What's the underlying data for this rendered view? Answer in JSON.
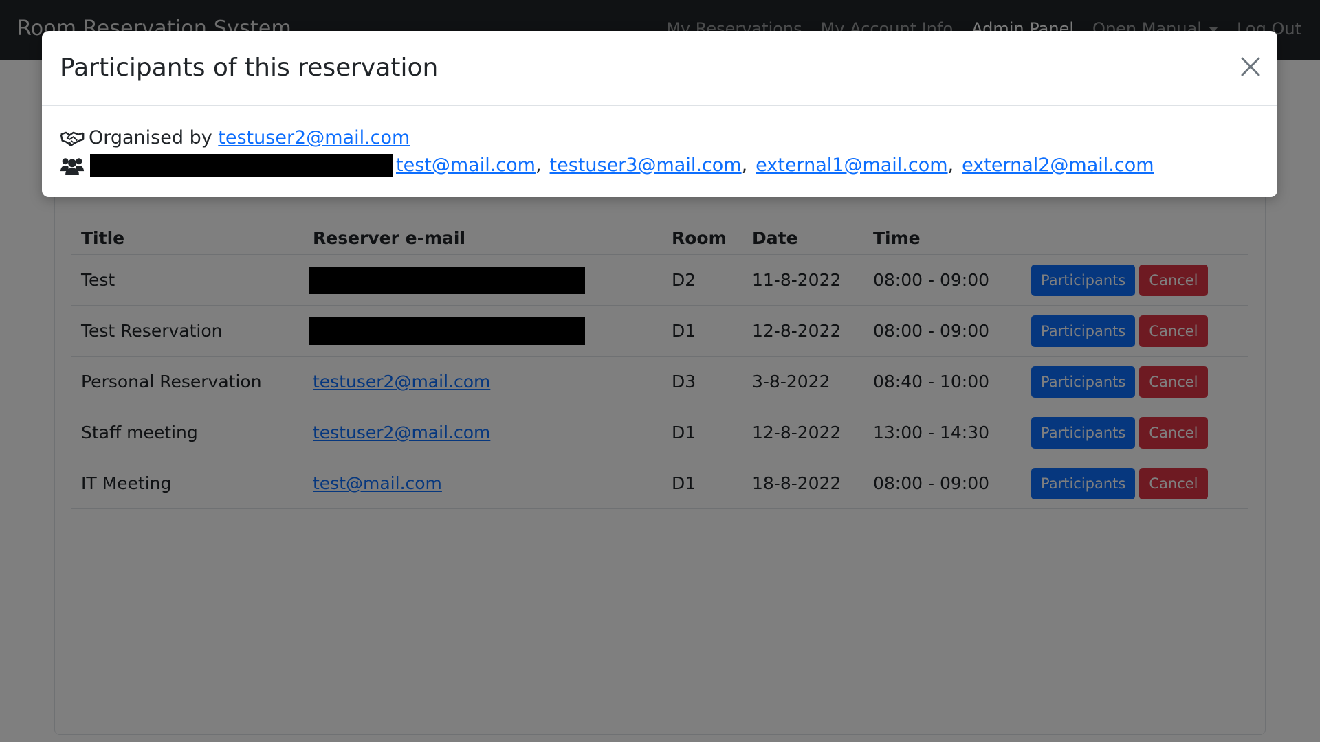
{
  "navbar": {
    "brand": "Room Reservation System",
    "links": [
      "My Reservations",
      "My Account Info",
      "Admin Panel",
      "Open Manual",
      "Log Out"
    ],
    "active_link": "Admin Panel"
  },
  "table": {
    "headers": [
      "Title",
      "Reserver e-mail",
      "Room",
      "Date",
      "Time"
    ],
    "rows": [
      {
        "title": "Test",
        "email": "",
        "email_redacted": true,
        "room": "D2",
        "date": "11-8-2022",
        "time": "08:00 - 09:00"
      },
      {
        "title": "Test Reservation",
        "email": "",
        "email_redacted": true,
        "room": "D1",
        "date": "12-8-2022",
        "time": "08:00 - 09:00"
      },
      {
        "title": "Personal Reservation",
        "email": "testuser2@mail.com",
        "email_redacted": false,
        "room": "D3",
        "date": "3-8-2022",
        "time": "08:40 - 10:00"
      },
      {
        "title": "Staff meeting",
        "email": "testuser2@mail.com",
        "email_redacted": false,
        "room": "D1",
        "date": "12-8-2022",
        "time": "13:00 - 14:30"
      },
      {
        "title": "IT Meeting",
        "email": "test@mail.com",
        "email_redacted": false,
        "room": "D1",
        "date": "18-8-2022",
        "time": "08:00 - 09:00"
      }
    ],
    "participants_label": "Participants",
    "cancel_label": "Cancel"
  },
  "modal": {
    "title": "Participants of this reservation",
    "organised_prefix": "Organised by",
    "organiser_email": "testuser2@mail.com",
    "participants": [
      "test@mail.com",
      "testuser3@mail.com",
      "external1@mail.com",
      "external2@mail.com"
    ],
    "organiser_icon": "handshake-icon",
    "participants_icon": "users-icon"
  },
  "colors": {
    "primary": "#0d6efd",
    "danger": "#dc3545",
    "navbar": "#212529",
    "link": "#0d6efd"
  }
}
